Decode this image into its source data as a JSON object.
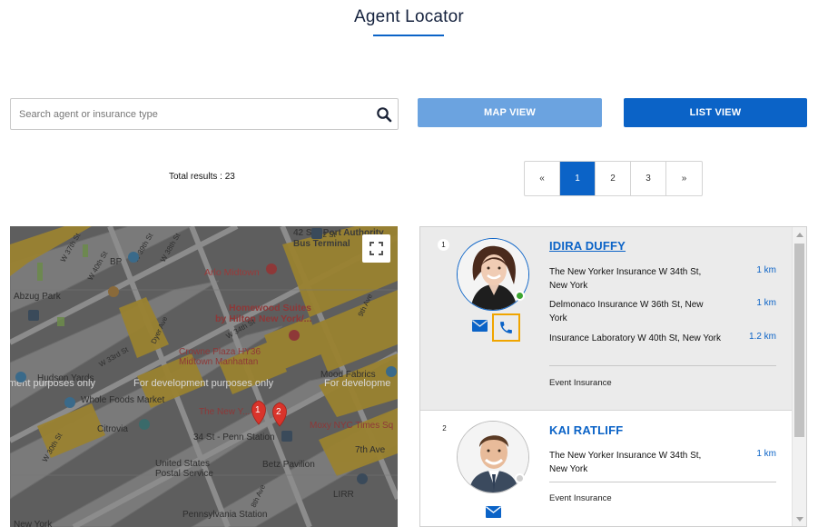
{
  "page": {
    "title": "Agent Locator"
  },
  "search": {
    "placeholder": "Search agent or insurance type"
  },
  "views": {
    "map_label": "MAP VIEW",
    "list_label": "LIST VIEW"
  },
  "results": {
    "total_text": "Total results : 23"
  },
  "pagination": {
    "prev": "«",
    "pages": [
      "1",
      "2",
      "3"
    ],
    "next": "»",
    "active_page": "1"
  },
  "map": {
    "labels": {
      "port_authority": "42 St - Port Authority\nBus Terminal",
      "arlo": "Arlo Midtown",
      "homewood": "Homewood Suites\nby Hilton New York/...",
      "abzug": "Abzug Park",
      "crowne": "Crowne Plaza HY36\nMidtown Manhattan",
      "mood": "Mood Fabrics",
      "hudson": "Hudson Yards",
      "whole_foods": "Whole Foods Market",
      "new_yorker": "The New Y...",
      "penn": "34 St - Penn Station",
      "moxy": "Moxy NYC Times Sq",
      "citrovia": "Citrovia",
      "seventh_ave": "7th Ave",
      "usps": "United States\nPostal Service",
      "betz": "Betz Pavilion",
      "lirr": "LIRR",
      "penn_station": "Pennsylvania Station",
      "new_york": "New York",
      "bp": "BP",
      "dev_left": "ment purposes only",
      "dev_center": "For development purposes only",
      "dev_right": "For developme",
      "w34": "W 34th St",
      "w33": "W 33rd St",
      "w30": "W 30th St",
      "w39": "W 39th St",
      "w37": "W 37th St",
      "w38": "W 38th St",
      "w40": "W 40th St",
      "ninth_ave": "9th Ave",
      "eighth_ave": "8th Ave",
      "dyer": "Dyer Ave",
      "st42": "42 St"
    },
    "markers": [
      "1",
      "2"
    ]
  },
  "agents": [
    {
      "number": "1",
      "name": "IDIRA DUFFY",
      "status": "online",
      "locations": [
        {
          "address": "The New Yorker Insurance W 34th St, New York",
          "distance": "1 km"
        },
        {
          "address": "Delmonaco Insurance W 36th St, New York",
          "distance": "1 km"
        },
        {
          "address": "Insurance Laboratory W 40th St, New York",
          "distance": "1.2 km"
        }
      ],
      "category": "Event Insurance"
    },
    {
      "number": "2",
      "name": "KAI RATLIFF",
      "status": "offline",
      "locations": [
        {
          "address": "The New Yorker Insurance W 34th St, New York",
          "distance": "1 km"
        }
      ],
      "category": "Event Insurance"
    }
  ],
  "colors": {
    "brand": "#0b63c7",
    "brand_light": "#6ba3e0",
    "highlight": "#f0a500",
    "online": "#3ca531"
  }
}
